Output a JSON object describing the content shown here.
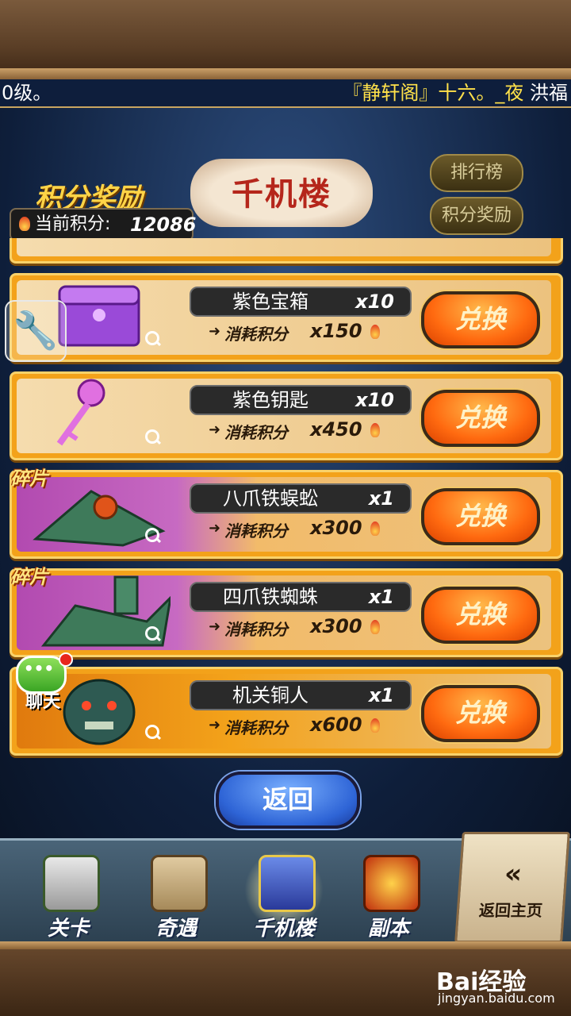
{
  "ticker": {
    "left_text": "0级。",
    "right_highlight": "『静轩阁』十六。_夜",
    "right_tail": "洪福"
  },
  "header": {
    "logo": "千机楼",
    "section_title": "积分奖励",
    "points_label": "当前积分:",
    "points_value": "12086",
    "rank_button": "排行榜",
    "reward_button": "积分奖励"
  },
  "items": [
    {
      "name": "紫色宝箱",
      "qty": "x10",
      "cost_label": "消耗积分",
      "cost": "x150",
      "button": "兑换",
      "tag": ""
    },
    {
      "name": "紫色钥匙",
      "qty": "x10",
      "cost_label": "消耗积分",
      "cost": "x450",
      "button": "兑换",
      "tag": ""
    },
    {
      "name": "八爪铁蜈蚣",
      "qty": "x1",
      "cost_label": "消耗积分",
      "cost": "x300",
      "button": "兑换",
      "tag": "碎片"
    },
    {
      "name": "四爪铁蜘蛛",
      "qty": "x1",
      "cost_label": "消耗积分",
      "cost": "x300",
      "button": "兑换",
      "tag": "碎片"
    },
    {
      "name": "机关铜人",
      "qty": "x1",
      "cost_label": "消耗积分",
      "cost": "x600",
      "button": "兑换",
      "tag": ""
    }
  ],
  "chat": {
    "label": "聊天",
    "dots": "•••"
  },
  "back_button": "返回",
  "nav": {
    "items": [
      {
        "label": "关卡"
      },
      {
        "label": "奇遇"
      },
      {
        "label": "千机楼"
      },
      {
        "label": "副本"
      }
    ],
    "home_chevron": "«",
    "home_label": "返回主页"
  },
  "watermark": {
    "brand": "Bai经验",
    "url": "jingyan.baidu.com"
  },
  "colors": {
    "card": "#f3a21a",
    "exchange_btn": "#ff6a10",
    "back_btn": "#2e64d6",
    "title_gold": "#ffd447"
  }
}
